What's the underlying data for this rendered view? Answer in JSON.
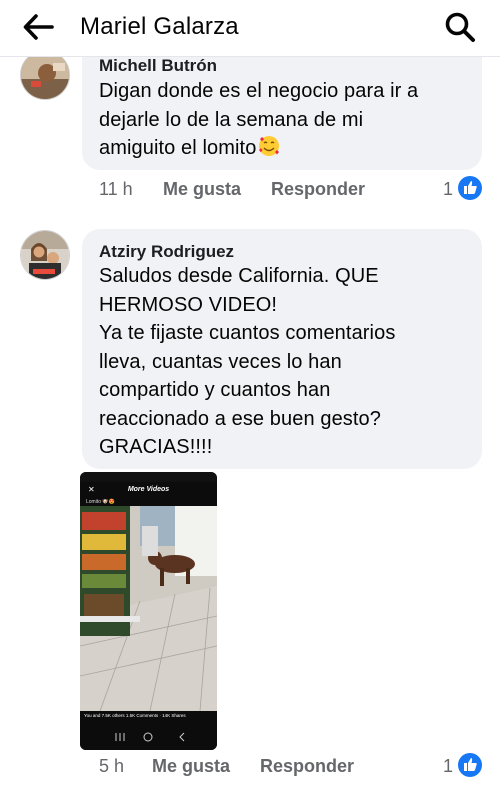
{
  "header": {
    "title": "Mariel Galarza"
  },
  "comments": [
    {
      "author": "Michell Butrón",
      "lines": [
        "Digan donde es el negocio para ir a",
        "dejarle lo de la semana de mi",
        "amiguito el lomito"
      ],
      "emoji": "smiling-face-with-hearts-icon",
      "time": "11 h",
      "like_label": "Me gusta",
      "reply_label": "Responder",
      "reaction_count": "1"
    },
    {
      "author": "Atziry Rodriguez",
      "lines": [
        "Saludos desde California. QUE",
        "HERMOSO VIDEO!",
        "Ya te fijaste cuantos comentarios",
        "lleva, cuantas veces lo han",
        "compartido y cuantos han",
        "reaccionado a ese buen gesto?",
        "GRACIAS!!!!"
      ],
      "attachment": {
        "title": "More Videos",
        "caption": "Lomito 🐶😍",
        "stats": "You and 7.5K others  1.5K Comments · 14K Shares"
      },
      "time": "5 h",
      "like_label": "Me gusta",
      "reply_label": "Responder",
      "reaction_count": "1"
    }
  ],
  "colors": {
    "facebook_blue": "#1877f2",
    "bubble_bg": "#f0f2f5",
    "meta_gray": "#65676b"
  }
}
